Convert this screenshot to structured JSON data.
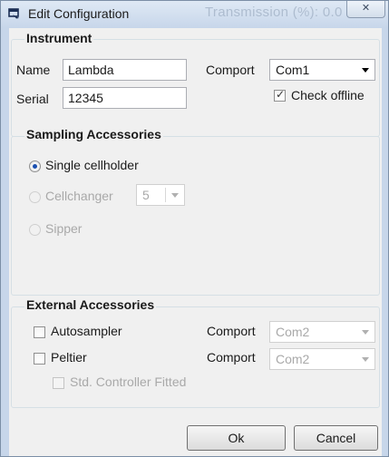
{
  "window": {
    "title": "Edit Configuration",
    "ghost_text": "Transmission (%): 0.0",
    "close_glyph": "✕"
  },
  "instrument": {
    "legend": "Instrument",
    "name_label": "Name",
    "name_value": "Lambda",
    "serial_label": "Serial",
    "serial_value": "12345",
    "comport_label": "Comport",
    "comport_value": "Com1",
    "check_offline_label": "Check offline",
    "check_offline_checked": true
  },
  "sampling": {
    "legend": "Sampling Accessories",
    "single_label": "Single cellholder",
    "single_selected": true,
    "cellchanger_label": "Cellchanger",
    "cellchanger_value": "5",
    "sipper_label": "Sipper"
  },
  "external": {
    "legend": "External Accessories",
    "autosampler_label": "Autosampler",
    "autosampler_comport_label": "Comport",
    "autosampler_comport_value": "Com2",
    "peltier_label": "Peltier",
    "peltier_comport_label": "Comport",
    "peltier_comport_value": "Com2",
    "std_controller_label": "Std. Controller Fitted"
  },
  "buttons": {
    "ok": "Ok",
    "cancel": "Cancel"
  },
  "colors": {
    "titlebar": "#c7d6ea",
    "radio_dot": "#1a4fb0"
  }
}
